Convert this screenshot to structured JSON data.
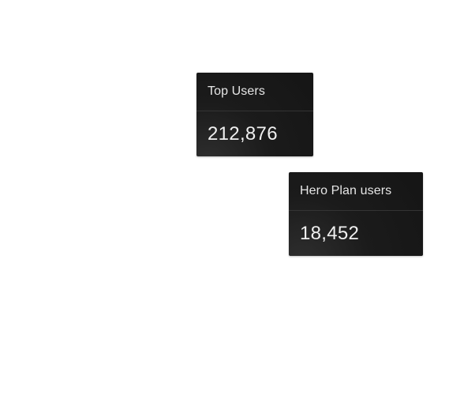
{
  "cards": [
    {
      "title": "Top Users",
      "value": "212,876"
    },
    {
      "title": "Hero Plan users",
      "value": "18,452"
    }
  ],
  "colors": {
    "card_background": "#1a1a1a",
    "card_text": "#e6e6e6",
    "page_background": "#ffffff"
  }
}
